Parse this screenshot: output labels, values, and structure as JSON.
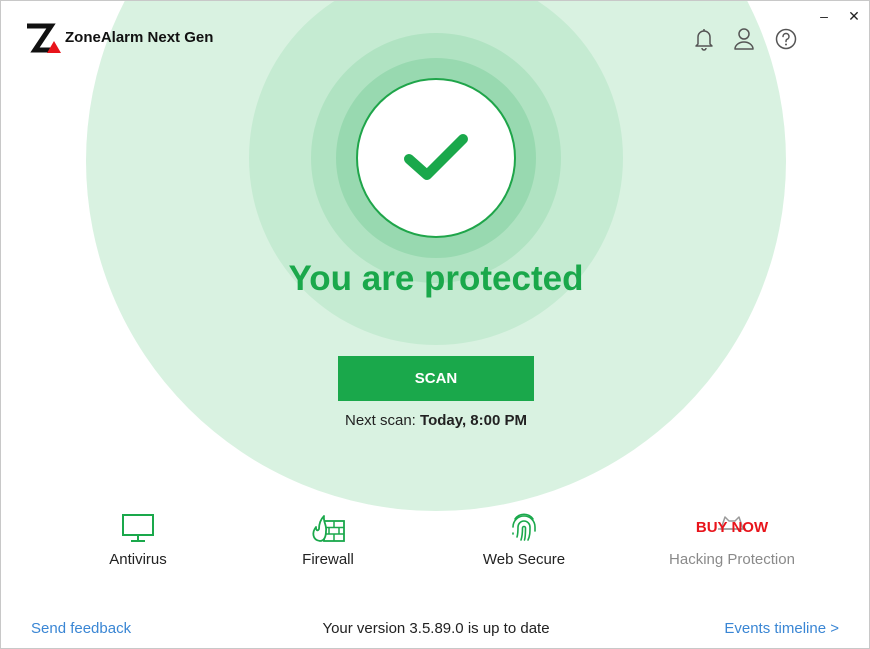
{
  "app": {
    "title": "ZoneAlarm Next Gen"
  },
  "window_controls": {
    "minimize": "–",
    "close": "✕"
  },
  "header_icons": [
    "bell-icon",
    "user-icon",
    "help-icon"
  ],
  "status": {
    "headline": "You are protected",
    "icon": "checkmark-icon"
  },
  "scan": {
    "button_label": "SCAN",
    "next_scan_prefix": "Next scan:",
    "next_scan_value": "Today, 8:00 PM"
  },
  "features": [
    {
      "label": "Antivirus",
      "icon": "monitor-icon",
      "enabled": true
    },
    {
      "label": "Firewall",
      "icon": "firewall-icon",
      "enabled": true
    },
    {
      "label": "Web Secure",
      "icon": "fingerprint-icon",
      "enabled": true
    },
    {
      "label": "Hacking Protection",
      "icon": "hacker-icon",
      "enabled": false,
      "badge": "BUY NOW"
    }
  ],
  "footer": {
    "left_link": "Send feedback",
    "status": "Your version 3.5.89.0 is up to date",
    "right_link": "Events timeline >"
  },
  "colors": {
    "accent": "#1aa84b",
    "link": "#3a86d4",
    "buy_now": "#e8141b",
    "disabled_text": "#8a8a8a"
  }
}
